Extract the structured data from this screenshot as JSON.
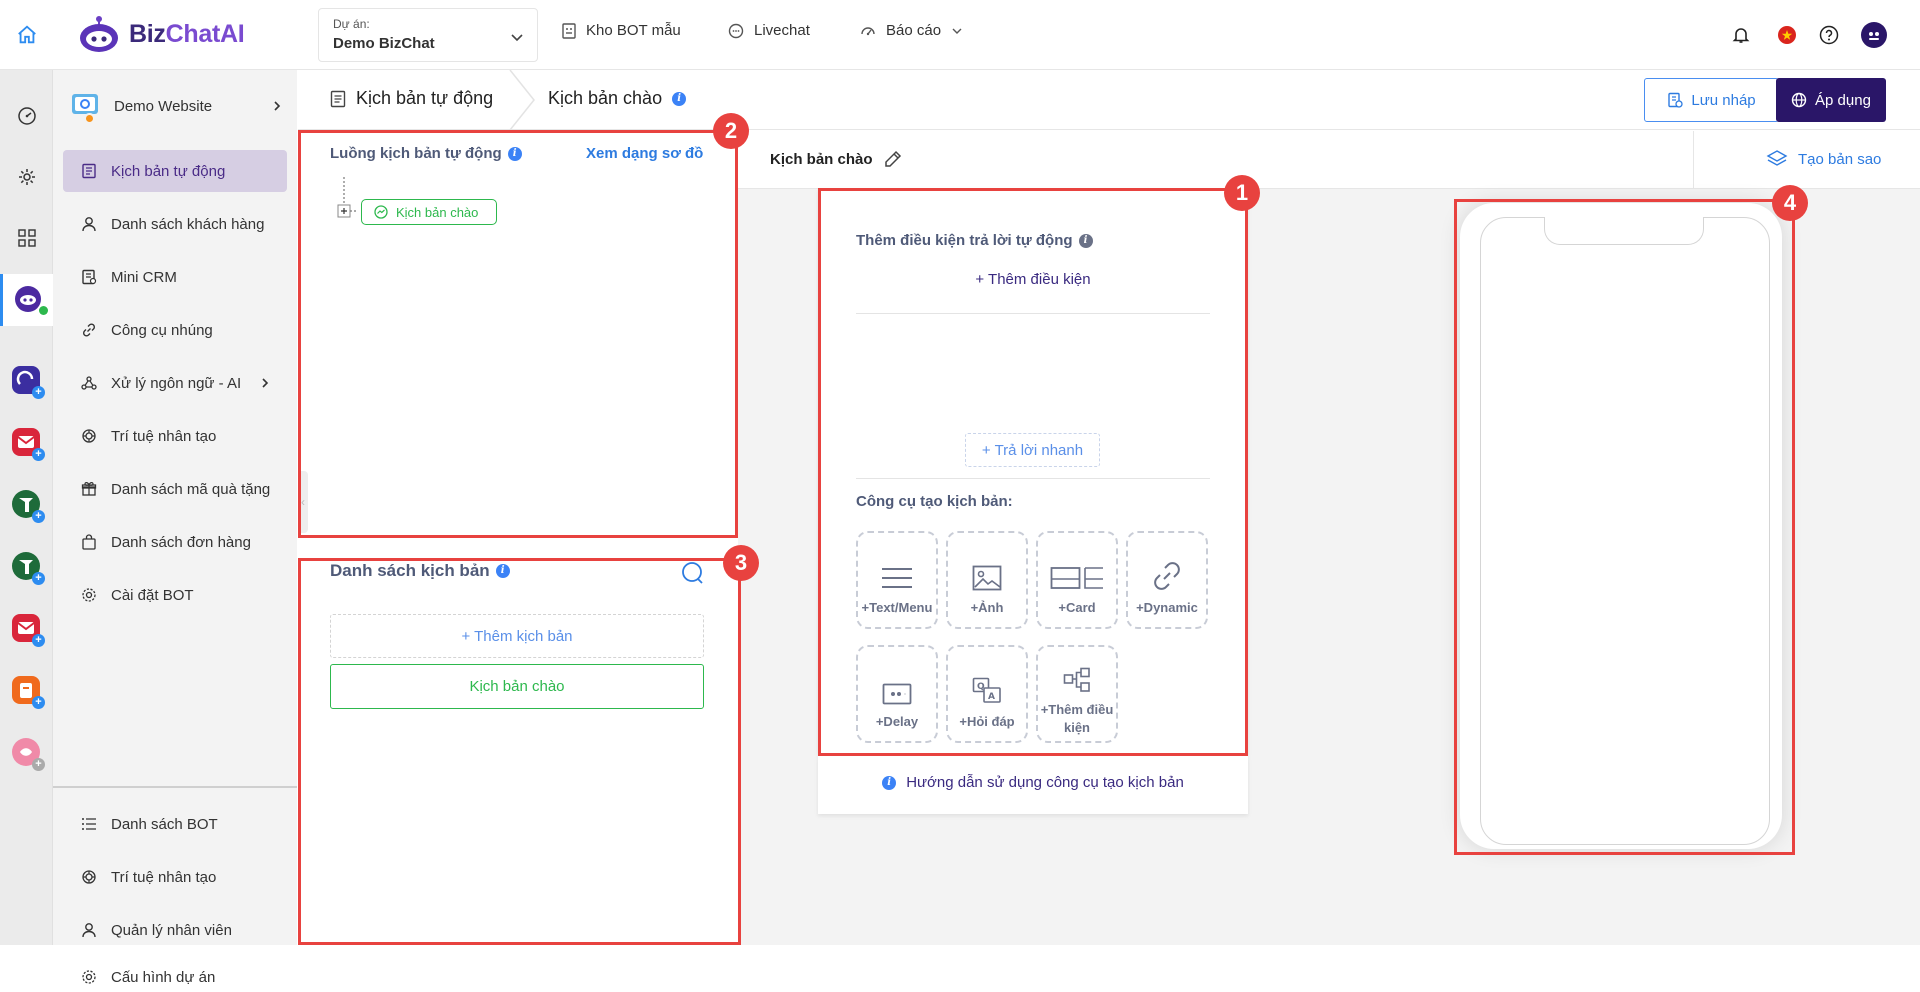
{
  "app": {
    "brand_part1": "Biz",
    "brand_part2": "ChatAI"
  },
  "topbar": {
    "project_label": "Dự án:",
    "project_value": "Demo BizChat",
    "nav": [
      "Kho BOT mẫu",
      "Livechat",
      "Báo cáo"
    ]
  },
  "sidebar": {
    "site_name": "Demo Website",
    "items": [
      "Kịch bản tự động",
      "Danh sách khách hàng",
      "Mini CRM",
      "Công cụ nhúng",
      "Xử lý ngôn ngữ - AI",
      "Trí tuệ nhân tạo",
      "Danh sách mã quà tặng",
      "Danh sách đơn hàng",
      "Cài đặt BOT"
    ],
    "bottom_items": [
      "Danh sách BOT",
      "Trí tuệ nhân tạo",
      "Quản lý nhân viên",
      "Cấu hình dự án"
    ]
  },
  "breadcrumb": {
    "parent": "Kịch bản tự động",
    "current": "Kịch bản chào"
  },
  "actions": {
    "draft": "Lưu nháp",
    "apply": "Áp dụng",
    "duplicate": "Tạo bản sao"
  },
  "flow_panel": {
    "title": "Luồng kịch bản tự động",
    "diagram_link": "Xem dạng sơ đồ",
    "node_label": "Kịch bản chào"
  },
  "list_panel": {
    "title": "Danh sách kịch bản",
    "add_button": "+ Thêm kịch bản",
    "items": [
      "Kịch bản chào"
    ]
  },
  "editor": {
    "script_name": "Kịch bản chào",
    "condition_title": "Thêm điều kiện trả lời tự động",
    "add_condition": "+ Thêm điều kiện",
    "quick_reply": "+ Trả lời nhanh",
    "tools_title": "Công cụ tạo kịch bản:",
    "tools": [
      "+Text/Menu",
      "+Ảnh",
      "+Card",
      "+Dynamic",
      "+Delay",
      "+Hỏi đáp",
      "+Thêm điều kiện"
    ],
    "guide": "Hướng dẫn sử dụng công cụ tạo kịch bản"
  },
  "annotations": [
    "1",
    "2",
    "3",
    "4"
  ],
  "colors": {
    "brand": "#2a1668",
    "accent": "#3b82f6",
    "highlight": "#e8423f",
    "success": "#2db84d"
  }
}
